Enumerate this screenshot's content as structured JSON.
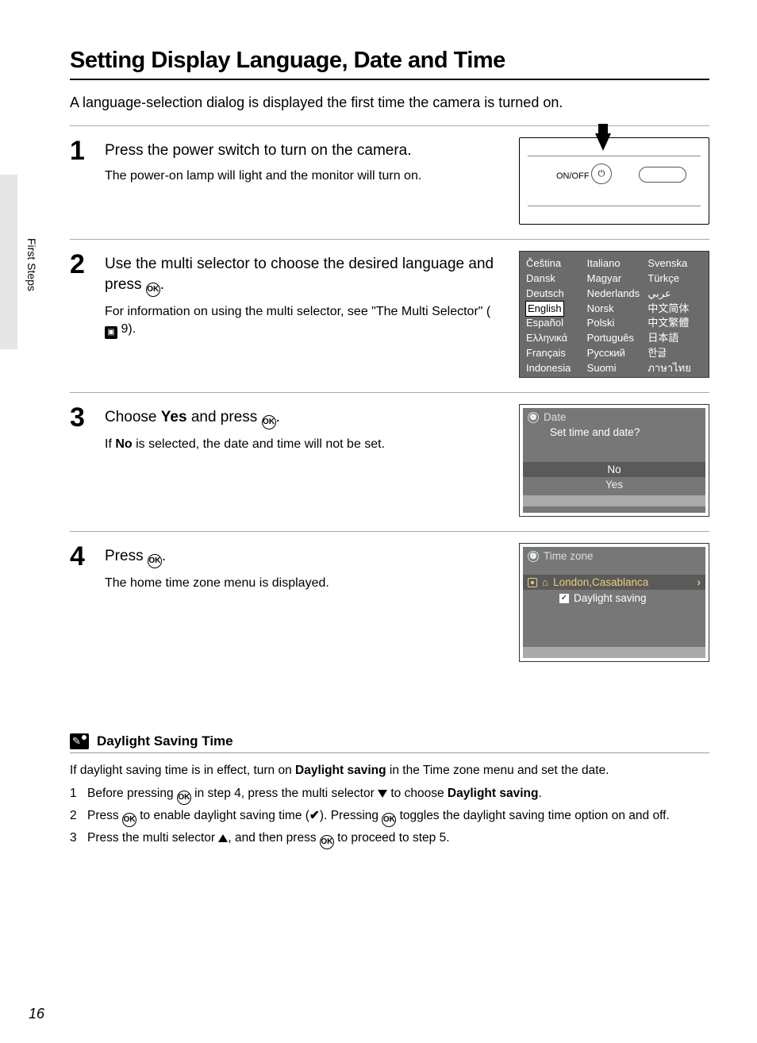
{
  "side_tab": "First Steps",
  "title": "Setting Display Language, Date and Time",
  "intro": "A language-selection dialog is displayed the first time the camera is turned on.",
  "page_number": "16",
  "steps": {
    "s1": {
      "num": "1",
      "title": "Press the power switch to turn on the camera.",
      "desc": "The power-on lamp will light and the monitor will turn on.",
      "fig": {
        "onoff": "ON/OFF"
      }
    },
    "s2": {
      "num": "2",
      "title_a": "Use the multi selector to choose the desired language and press ",
      "title_b": ".",
      "desc_a": "For information on using the multi selector, see \"The Multi Selector\" (",
      "desc_ref": "9",
      "desc_b": ").",
      "languages": {
        "col1": [
          "Čeština",
          "Dansk",
          "Deutsch",
          "English",
          "Español",
          "Ελληνικά",
          "Français",
          "Indonesia"
        ],
        "col2": [
          "Italiano",
          "Magyar",
          "Nederlands",
          "Norsk",
          "Polski",
          "Português",
          "Русский",
          "Suomi"
        ],
        "col3": [
          "Svenska",
          "Türkçe",
          "عربي",
          "中文简体",
          "中文繁體",
          "日本語",
          "한글",
          "ภาษาไทย"
        ],
        "selected": "English"
      }
    },
    "s3": {
      "num": "3",
      "title_a": "Choose ",
      "title_bold": "Yes",
      "title_b": " and press ",
      "title_c": ".",
      "desc_a": "If ",
      "desc_bold": "No",
      "desc_b": " is selected, the date and time will not be set.",
      "dialog": {
        "header": "Date",
        "question": "Set time and date?",
        "opt_no": "No",
        "opt_yes": "Yes"
      }
    },
    "s4": {
      "num": "4",
      "title_a": "Press ",
      "title_b": ".",
      "desc": "The home time zone menu is displayed.",
      "dialog": {
        "header": "Time zone",
        "zone": "London,Casablanca",
        "daylight": "Daylight saving"
      }
    }
  },
  "note": {
    "title": "Daylight Saving Time",
    "intro_a": "If daylight saving time is in effect, turn on ",
    "intro_bold": "Daylight saving",
    "intro_b": " in the Time zone menu and set the date.",
    "items": {
      "i1_a": "Before pressing ",
      "i1_b": " in step 4, press the multi selector ",
      "i1_c": " to choose ",
      "i1_bold": "Daylight saving",
      "i1_d": ".",
      "i2_a": "Press ",
      "i2_b": " to enable daylight saving time (",
      "i2_c": "). Pressing ",
      "i2_d": " toggles the daylight saving time option on and off.",
      "i3_a": "Press the multi selector ",
      "i3_b": ", and then press ",
      "i3_c": " to proceed to step 5."
    }
  }
}
